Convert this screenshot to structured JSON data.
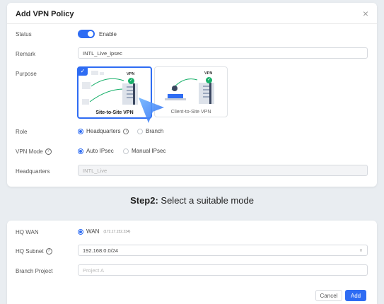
{
  "dialog": {
    "title": "Add VPN Policy"
  },
  "form": {
    "status_label": "Status",
    "status_toggle_text": "Enable",
    "remark_label": "Remark",
    "remark_value": "INTL_Live_ipsec",
    "purpose_label": "Purpose",
    "purpose_options": [
      {
        "label": "Site-to-Site VPN",
        "selected": true,
        "tag": "VPN"
      },
      {
        "label": "Client-to-Site VPN",
        "selected": false,
        "tag": "VPN"
      }
    ],
    "role_label": "Role",
    "role_options": [
      "Headquarters",
      "Branch"
    ],
    "vpn_mode_label": "VPN Mode",
    "vpn_mode_options": [
      "Auto IPsec",
      "Manual IPsec"
    ],
    "headquarters_label": "Headquarters",
    "headquarters_value": "INTL_Live"
  },
  "step": {
    "prefix": "Step2:",
    "text": " Select a suitable mode"
  },
  "bottom": {
    "hq_wan_label": "HQ WAN",
    "hq_wan_option": "WAN",
    "hq_wan_detail": "(172.17.152.234)",
    "hq_subnet_label": "HQ Subnet",
    "hq_subnet_value": "192.168.0.0/24",
    "branch_project_label": "Branch Project",
    "branch_project_placeholder": "Project A",
    "cancel_label": "Cancel",
    "add_label": "Add"
  },
  "colors": {
    "accent": "#2e6cf3",
    "success": "#18b06a"
  }
}
